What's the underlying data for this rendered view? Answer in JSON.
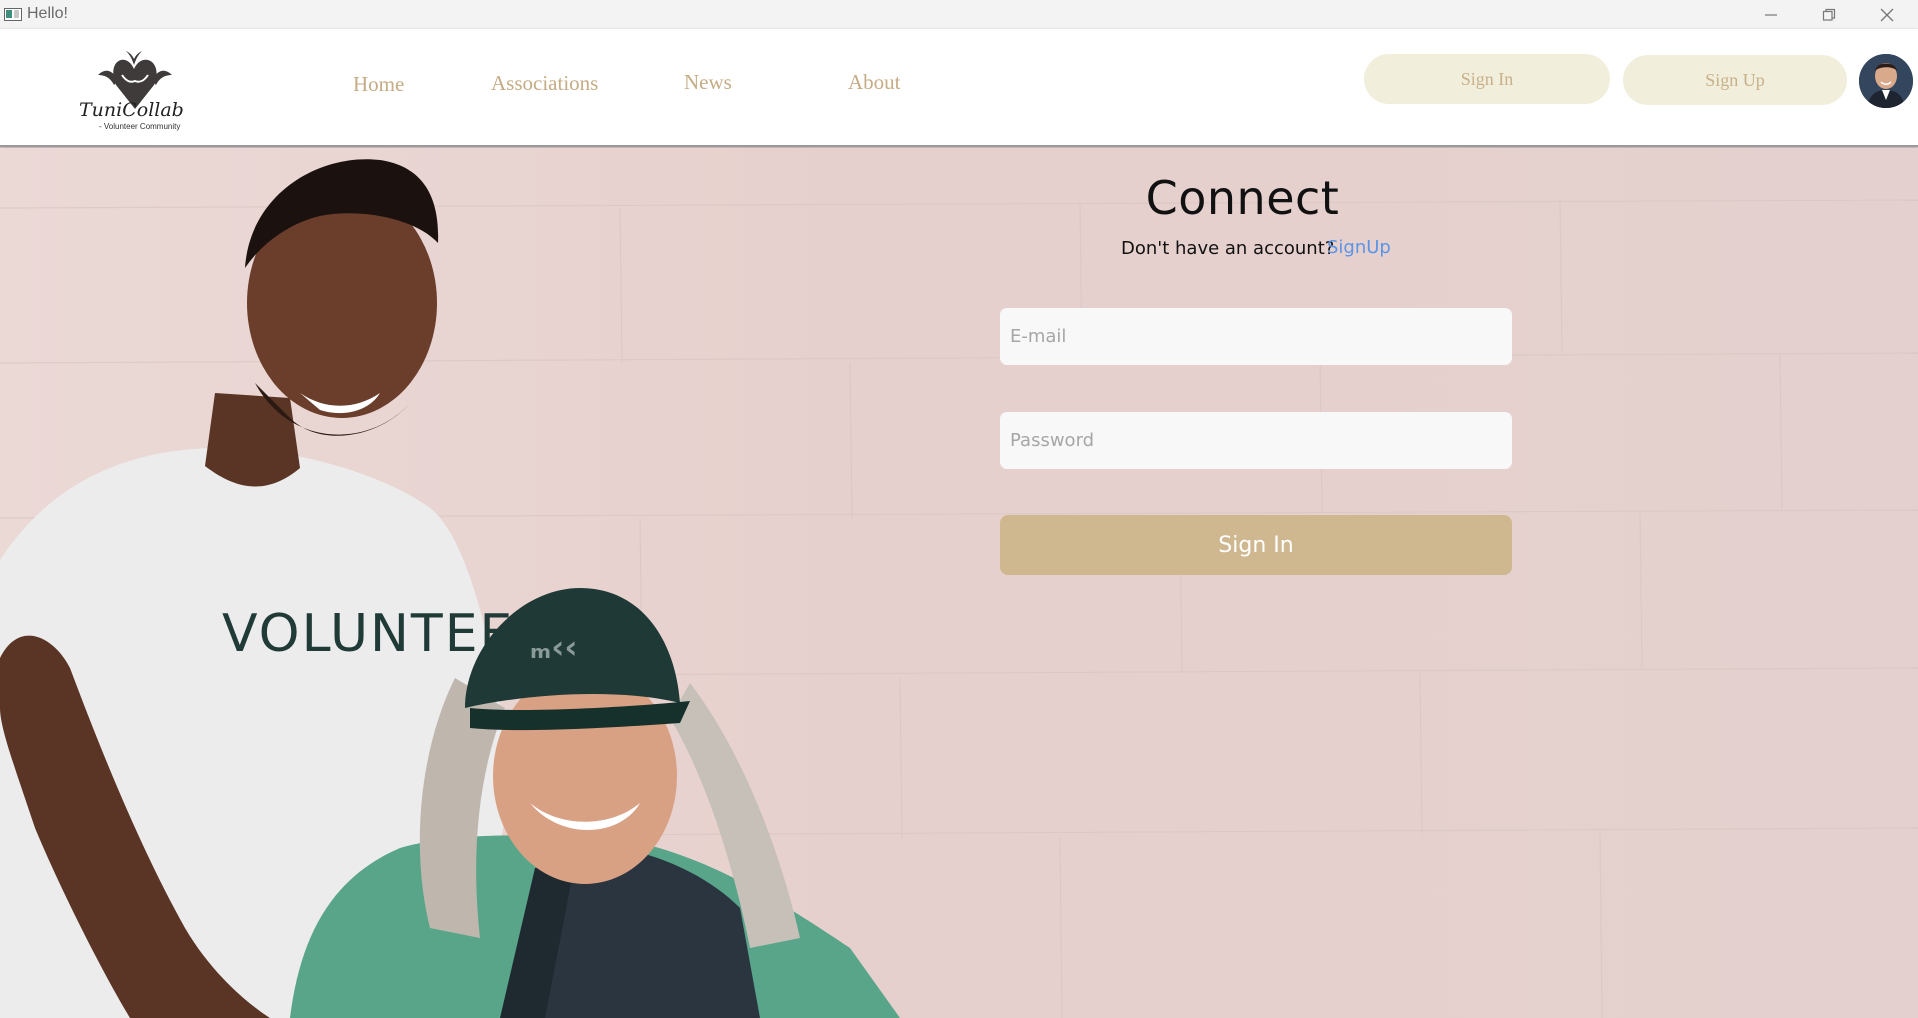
{
  "window": {
    "title": "Hello!",
    "controls": [
      "minimize-icon",
      "restore-icon",
      "close-icon"
    ]
  },
  "header": {
    "logo": {
      "name": "TuniCollab",
      "tagline": "- Volunteer Community"
    },
    "nav": [
      {
        "label": "Home"
      },
      {
        "label": "Associations"
      },
      {
        "label": "News"
      },
      {
        "label": "About"
      }
    ],
    "auth": {
      "sign_in": "Sign In",
      "sign_up": "Sign Up"
    },
    "avatar_icon": "user-avatar"
  },
  "hero": {
    "shirt_text": "VOLUNTEER"
  },
  "login": {
    "title": "Connect",
    "no_account_text": "Don't have an account?",
    "signup_link": "SignUp",
    "email": {
      "placeholder": "E-mail",
      "value": ""
    },
    "password": {
      "placeholder": "Password",
      "value": ""
    },
    "submit_label": "Sign In"
  },
  "colors": {
    "accent": "#cfb88f",
    "nav_text": "#c5ac84",
    "pill_bg": "#f2eedc",
    "link": "#5a95e6",
    "background": "#e8d6d4"
  }
}
